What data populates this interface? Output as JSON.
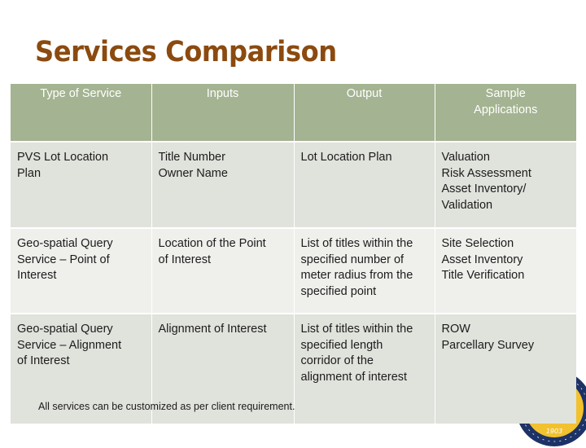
{
  "slide": {
    "title": "Services Comparison"
  },
  "colors": {
    "title": "#8b4a0f",
    "header_bg": "#a4b391",
    "row_dark_bg": "#e0e2dc",
    "row_light_bg": "#eff0ec",
    "seal_navy": "#1d3266",
    "seal_gold": "#f2c12e"
  },
  "table": {
    "headers": [
      "Type of Service",
      "Inputs",
      "Output",
      [
        "Sample",
        "Applications"
      ]
    ],
    "rows": [
      {
        "service": [
          "PVS Lot Location",
          "Plan"
        ],
        "inputs": [
          "Title Number",
          "Owner Name"
        ],
        "output": [
          "Lot Location Plan"
        ],
        "applications": [
          "Valuation",
          "Risk Assessment",
          "Asset Inventory/",
          "Validation"
        ]
      },
      {
        "service": [
          "Geo-spatial Query",
          "Service –  Point of",
          "Interest"
        ],
        "inputs": [
          "Location of the Point",
          "of Interest"
        ],
        "output": [
          "List of titles within the",
          "specified number of",
          "meter radius from the",
          "specified point"
        ],
        "applications": [
          "Site Selection",
          "Asset Inventory",
          "Title Verification"
        ]
      },
      {
        "service": [
          "Geo-spatial Query",
          "Service –  Alignment",
          "of Interest"
        ],
        "inputs": [
          "Alignment of Interest"
        ],
        "output": [
          "List of titles within the",
          "specified length",
          "corridor of the",
          "alignment of interest"
        ],
        "applications": [
          "ROW",
          "Parcellary Survey"
        ]
      }
    ]
  },
  "footnote": "All services can be customized as per client requirement.",
  "seal": {
    "icon": "seal-logo-icon",
    "year": "1903"
  }
}
